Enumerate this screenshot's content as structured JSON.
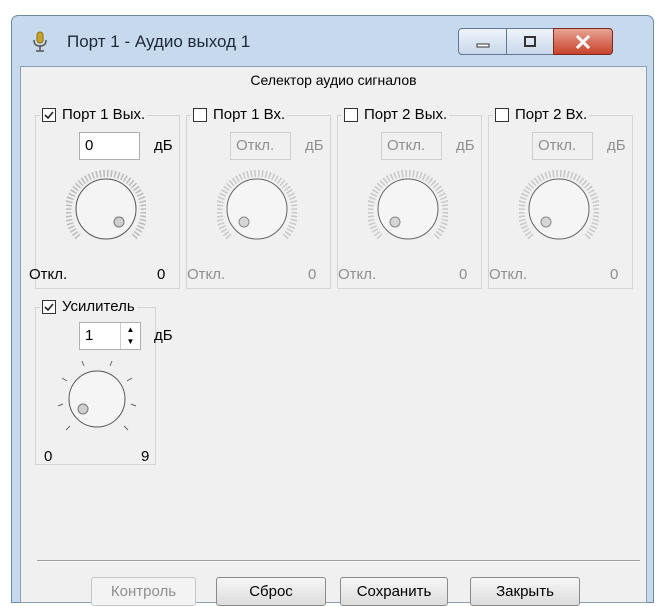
{
  "window": {
    "title": "Порт 1 - Аудио выход 1",
    "title_icon": "microphone-icon",
    "controls": [
      "minimize-icon",
      "maximize-icon",
      "close-icon"
    ]
  },
  "selector": {
    "title": "Селектор аудио сигналов",
    "ports": [
      {
        "label": "Порт 1 Вых.",
        "checked": true,
        "value": "0",
        "unit": "дБ",
        "min": "Откл.",
        "max": "0",
        "enabled": true
      },
      {
        "label": "Порт 1 Вх.",
        "checked": false,
        "value": "Откл.",
        "unit": "дБ",
        "min": "Откл.",
        "max": "0",
        "enabled": false
      },
      {
        "label": "Порт 2 Вых.",
        "checked": false,
        "value": "Откл.",
        "unit": "дБ",
        "min": "Откл.",
        "max": "0",
        "enabled": false
      },
      {
        "label": "Порт 2 Вх.",
        "checked": false,
        "value": "Откл.",
        "unit": "дБ",
        "min": "Откл.",
        "max": "0",
        "enabled": false
      }
    ]
  },
  "amplifier": {
    "label": "Усилитель",
    "checked": true,
    "value": "1",
    "unit": "дБ",
    "min": "0",
    "max": "9"
  },
  "buttons": {
    "monitor": "Контроль",
    "reset": "Сброс",
    "save": "Сохранить",
    "close": "Закрыть"
  },
  "colors": {
    "frame": "#c6d9ed",
    "close_button": "#c8422b",
    "dialog_bg": "#f0f0f0"
  }
}
